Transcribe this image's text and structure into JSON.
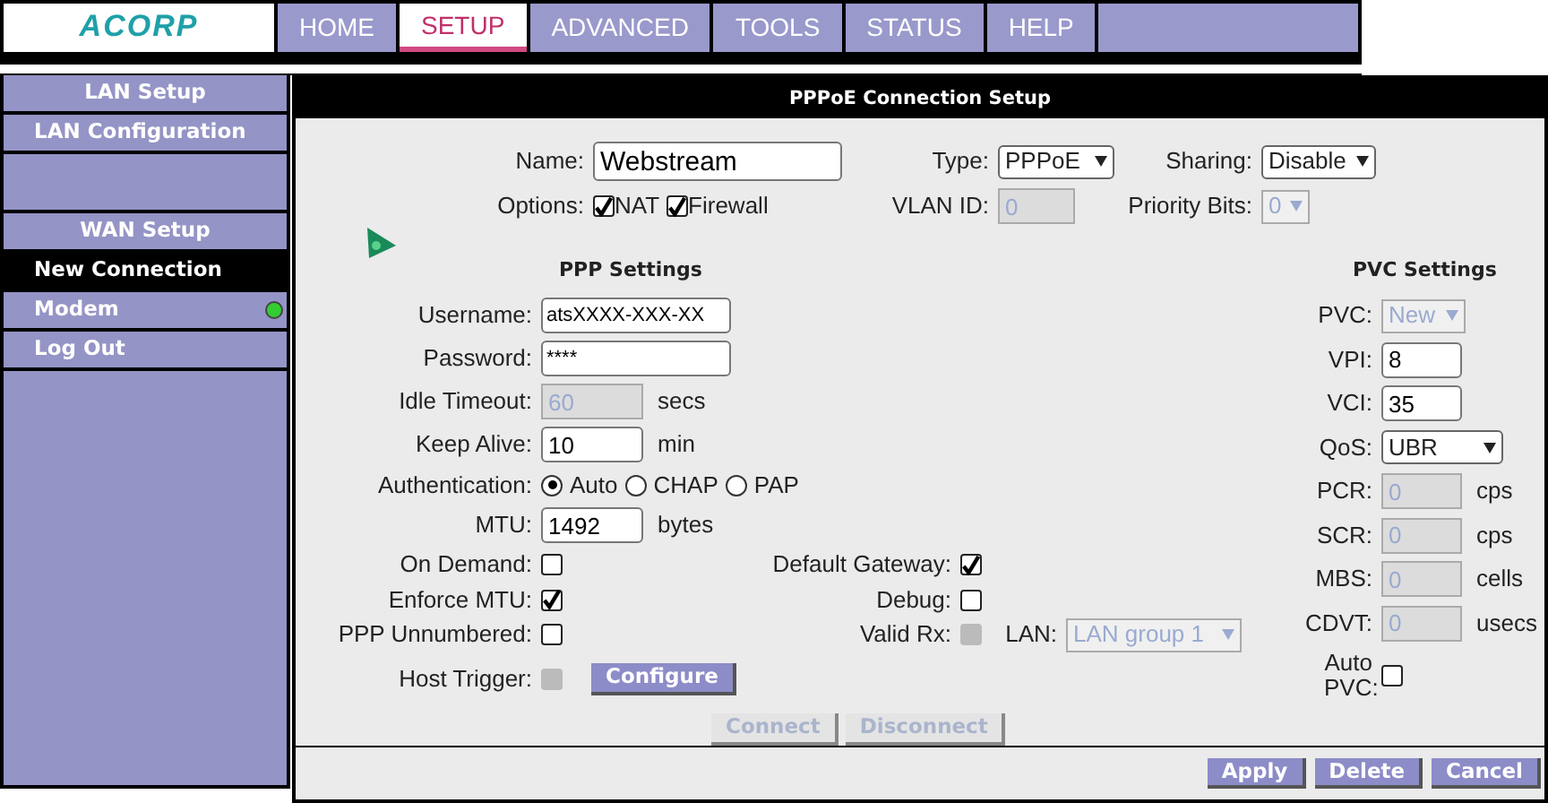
{
  "logo": "ACORP",
  "nav_tabs": [
    {
      "label": "HOME",
      "selected": false
    },
    {
      "label": "SETUP",
      "selected": true
    },
    {
      "label": "ADVANCED",
      "selected": false
    },
    {
      "label": "TOOLS",
      "selected": false
    },
    {
      "label": "STATUS",
      "selected": false
    },
    {
      "label": "HELP",
      "selected": false
    }
  ],
  "sidebar": {
    "items": [
      {
        "kind": "header",
        "label": "LAN Setup"
      },
      {
        "kind": "link",
        "label": "LAN Configuration",
        "selected": false
      },
      {
        "kind": "spacer"
      },
      {
        "kind": "header",
        "label": "WAN Setup"
      },
      {
        "kind": "link",
        "label": "New Connection",
        "selected": true
      },
      {
        "kind": "link",
        "label": "Modem",
        "selected": false,
        "color": "#33cc33"
      },
      {
        "kind": "link",
        "label": "Log Out",
        "selected": false
      }
    ]
  },
  "panel": {
    "title": "PPPoE Connection Setup",
    "name": {
      "label": "Name:",
      "value": "Webstream"
    },
    "type": {
      "label": "Type:",
      "value": "PPPoE",
      "disabled": false
    },
    "sharing": {
      "label": "Sharing:",
      "value": "Disable",
      "disabled": false
    },
    "options": {
      "label": "Options:",
      "items": [
        {
          "label": "NAT",
          "checked": true
        },
        {
          "label": "Firewall",
          "checked": true
        }
      ]
    },
    "vlan_id": {
      "label": "VLAN ID:",
      "value": "0",
      "disabled": true
    },
    "priority_bits": {
      "label": "Priority Bits:",
      "value": "0",
      "disabled": true
    },
    "ppp_settings": {
      "title": "PPP Settings",
      "rows": [
        {
          "kind": "text",
          "label": "Username:",
          "value": "atsXXXX-XXX-XX",
          "disabled": false
        },
        {
          "kind": "text",
          "label": "Password:",
          "value": "****",
          "disabled": false
        },
        {
          "kind": "short",
          "label": "Idle Timeout:",
          "value": "60",
          "unit": "secs",
          "disabled": true
        },
        {
          "kind": "short",
          "label": "Keep Alive:",
          "value": "10",
          "unit": "min",
          "disabled": false
        },
        {
          "kind": "radio",
          "label": "Authentication:",
          "options": [
            {
              "label": "Auto",
              "selected": true
            },
            {
              "label": "CHAP",
              "selected": false
            },
            {
              "label": "PAP",
              "selected": false
            }
          ]
        },
        {
          "kind": "short",
          "label": "MTU:",
          "value": "1492",
          "unit": "bytes",
          "disabled": false
        },
        {
          "kind": "checks",
          "items": [
            {
              "label": "On Demand:",
              "checked": false,
              "disabled": false
            },
            {
              "label": "Default Gateway:",
              "checked": true,
              "disabled": false
            }
          ]
        },
        {
          "kind": "checks",
          "items": [
            {
              "label": "Enforce MTU:",
              "checked": true,
              "disabled": false
            },
            {
              "label": "Debug:",
              "checked": false,
              "disabled": false
            }
          ]
        },
        {
          "kind": "checks",
          "items": [
            {
              "label": "PPP Unnumbered:",
              "checked": false,
              "disabled": false
            },
            {
              "label": "Valid Rx:",
              "checked": false,
              "disabled": true
            }
          ],
          "lan": {
            "label": "LAN:",
            "value": "LAN group 1",
            "disabled": true
          }
        },
        {
          "kind": "trigger",
          "label": "Host Trigger:",
          "checked": false,
          "disabled": true,
          "button": "Configure"
        }
      ]
    },
    "connect_buttons": [
      {
        "label": "Connect",
        "disabled": true
      },
      {
        "label": "Disconnect",
        "disabled": true
      }
    ],
    "pvc_settings": {
      "title": "PVC Settings",
      "rows": [
        {
          "kind": "select",
          "label": "PVC:",
          "value": "New",
          "disabled": true
        },
        {
          "kind": "text",
          "label": "VPI:",
          "value": "8",
          "disabled": false
        },
        {
          "kind": "text",
          "label": "VCI:",
          "value": "35",
          "disabled": false
        },
        {
          "kind": "wideselect",
          "label": "QoS:",
          "value": "UBR",
          "disabled": false
        },
        {
          "kind": "text",
          "label": "PCR:",
          "value": "0",
          "unit": "cps",
          "disabled": true
        },
        {
          "kind": "text",
          "label": "SCR:",
          "value": "0",
          "unit": "cps",
          "disabled": true
        },
        {
          "kind": "text",
          "label": "MBS:",
          "value": "0",
          "unit": "cells",
          "disabled": true
        },
        {
          "kind": "text",
          "label": "CDVT:",
          "value": "0",
          "unit": "usecs",
          "disabled": true
        },
        {
          "kind": "check",
          "label": "Auto PVC:",
          "checked": false,
          "disabled": false
        }
      ]
    },
    "footer_buttons": [
      "Apply",
      "Delete",
      "Cancel"
    ]
  }
}
